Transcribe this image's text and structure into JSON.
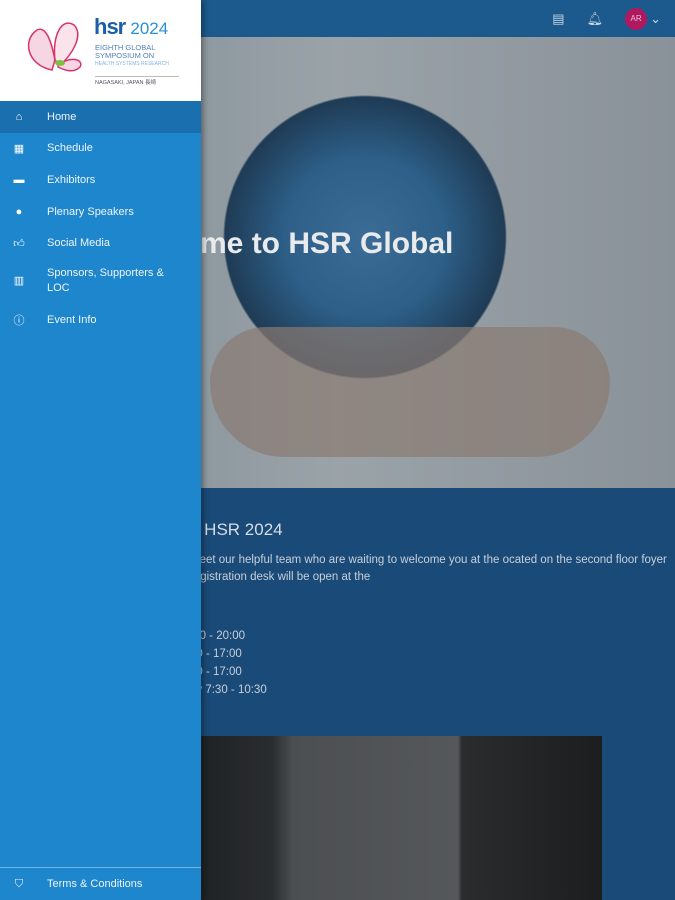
{
  "topbar": {
    "avatar_initials": "AR",
    "icons": [
      "chat-icon",
      "bell-icon",
      "chevron-down-icon"
    ]
  },
  "hero": {
    "title": "me to HSR Global"
  },
  "welcome": {
    "title": "o HSR 2024",
    "paragraph": "meet our helpful team who are waiting to welcome you at the ocated on the second floor foyer registration desk will be open at the",
    "hours": [
      ":00 - 20:00",
      "30 - 17:00",
      "30 - 17:00",
      "ay 7:30 - 10:30"
    ]
  },
  "logo": {
    "brand": "hsr",
    "year": "2024",
    "line1": "EIGHTH GLOBAL",
    "line2": "SYMPOSIUM ON",
    "line3": "HEALTH SYSTEMS RESEARCH",
    "line4": "NAGASAKI, JAPAN 長崎"
  },
  "nav": [
    {
      "label": "Home",
      "icon": "home-icon"
    },
    {
      "label": "Schedule",
      "icon": "calendar-icon"
    },
    {
      "label": "Exhibitors",
      "icon": "exhibitor-icon"
    },
    {
      "label": "Plenary Speakers",
      "icon": "person-icon"
    },
    {
      "label": "Social Media",
      "icon": "thumbs-up-icon"
    },
    {
      "label": "Sponsors, Supporters & LOC",
      "icon": "building-icon"
    },
    {
      "label": "Event Info",
      "icon": "info-icon"
    }
  ],
  "terms": {
    "label": "Terms & Conditions",
    "icon": "shield-icon"
  }
}
